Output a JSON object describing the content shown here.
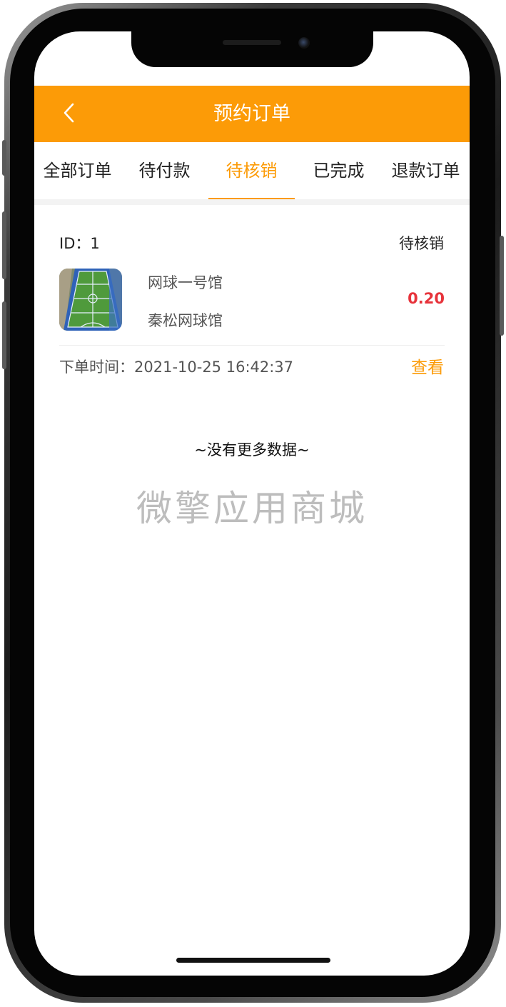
{
  "header": {
    "title": "预约订单",
    "back_icon": "chevron-left-icon"
  },
  "tabs": [
    {
      "label": "全部订单",
      "active": false
    },
    {
      "label": "待付款",
      "active": false
    },
    {
      "label": "待核销",
      "active": true
    },
    {
      "label": "已完成",
      "active": false
    },
    {
      "label": "退款订单",
      "active": false
    }
  ],
  "order": {
    "id_label": "ID：1",
    "status": "待核销",
    "venue_name": "网球一号馆",
    "venue_sub": "秦松网球馆",
    "price": "0.20",
    "time_label": "下单时间：2021-10-25 16:42:37",
    "view_label": "查看"
  },
  "list_end": "~没有更多数据~",
  "watermark": "微擎应用商城",
  "colors": {
    "accent": "#fc9b07",
    "price": "#e7333b"
  }
}
